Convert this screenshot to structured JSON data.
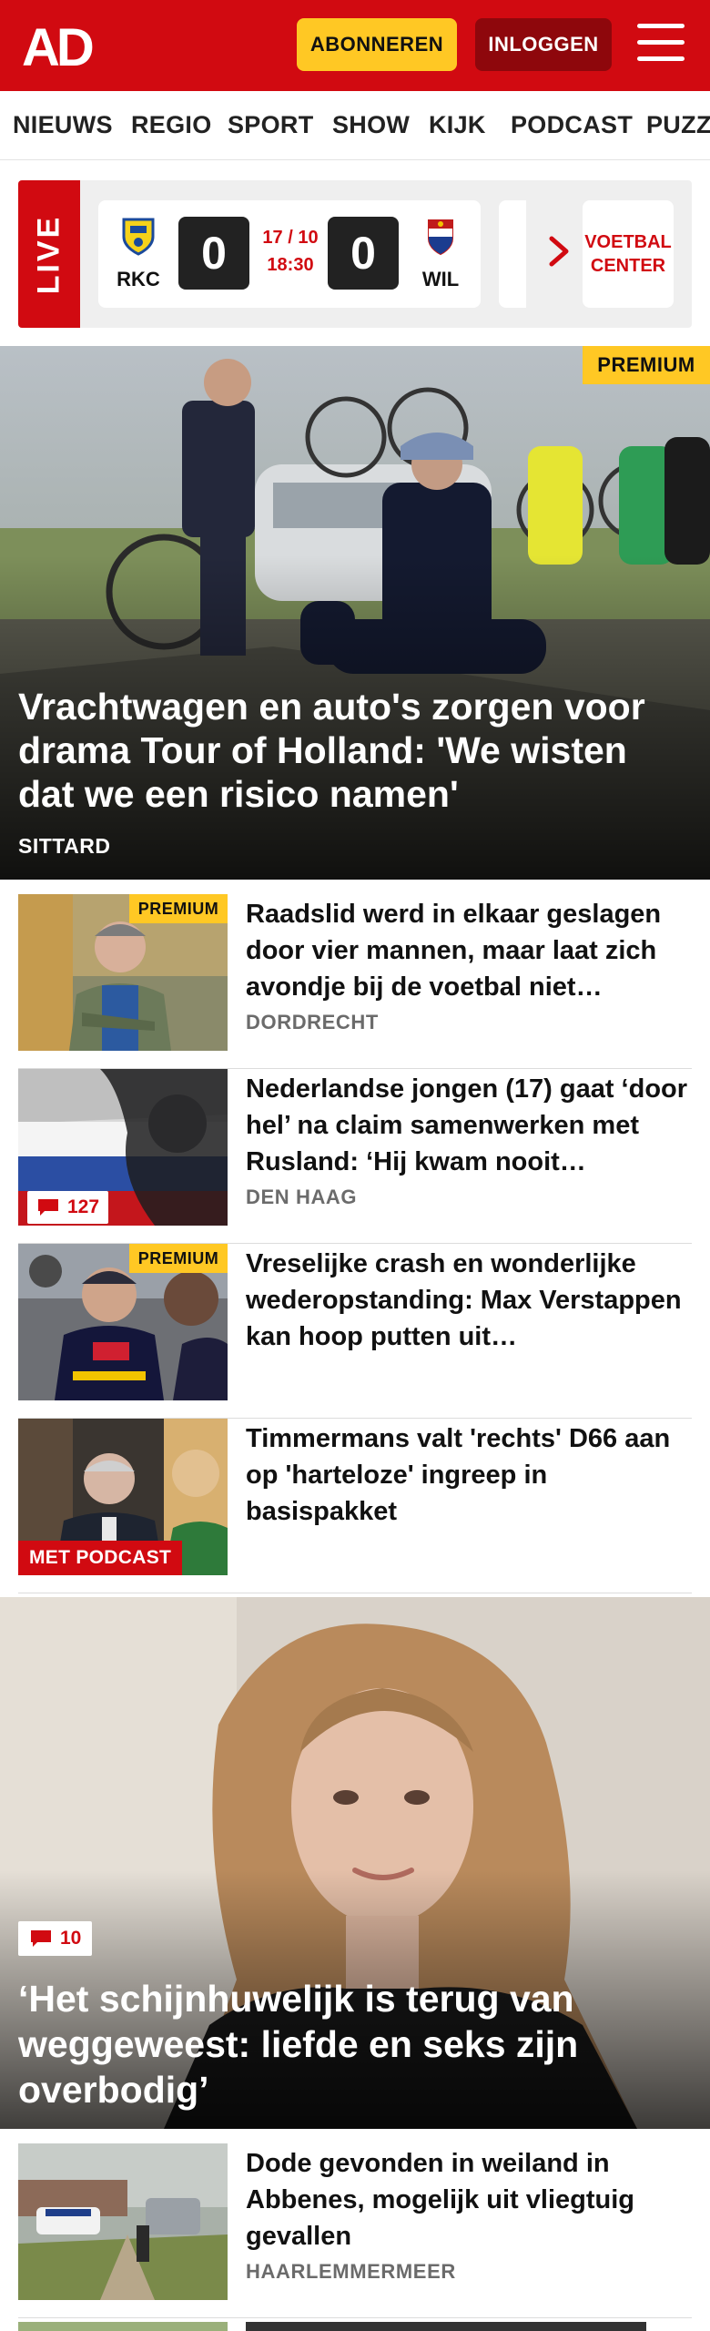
{
  "header": {
    "logo_text": "AD",
    "subscribe_label": "ABONNEREN",
    "login_label": "INLOGGEN",
    "menu_icon": "hamburger-icon",
    "brand_color": "#d10a11",
    "accent_color": "#ffc824"
  },
  "nav": {
    "items": [
      "NIEUWS",
      "REGIO",
      "SPORT",
      "SHOW",
      "KIJK",
      "PODCAST",
      "PUZZ"
    ]
  },
  "live": {
    "label": "LIVE",
    "match": {
      "home": "RKC",
      "away": "WIL",
      "home_score": "0",
      "away_score": "0",
      "date": "17 / 10",
      "time": "18:30"
    },
    "next_icon": "chevron-right-icon",
    "center_label": "VOETBAL CENTER"
  },
  "hero": {
    "badge": "PREMIUM",
    "title": "Vrachtwagen en auto's zorgen voor drama Tour of Holland: 'We wisten dat we een risico namen'",
    "location": "SITTARD"
  },
  "articles": [
    {
      "title": "Raadslid werd in elkaar geslagen door vier mannen, maar laat zich avondje bij de voetbal niet…",
      "location": "DORDRECHT",
      "badge": "PREMIUM"
    },
    {
      "title": "Nederlandse jongen (17) gaat ‘door hel’ na claim samenwerken met Rusland: ‘Hij kwam nooit…",
      "location": "DEN HAAG",
      "comments": "127"
    },
    {
      "title": "Vreselijke crash en wonderlijke wederopstanding: Max Verstappen kan hoop putten uit…",
      "badge": "PREMIUM"
    },
    {
      "title": "Timmermans valt 'rechts' D66 aan op 'harteloze' ingreep in basispakket",
      "tag": "MET PODCAST"
    }
  ],
  "hero2": {
    "comments": "10",
    "title": "‘Het schijnhuwelijk is terug van weggeweest: liefde en seks zijn overbodig’"
  },
  "articles2": [
    {
      "title": "Dode gevonden in weiland in Abbenes, mogelijk uit vliegtuig gevallen",
      "location": "HAARLEMMERMEER"
    }
  ]
}
